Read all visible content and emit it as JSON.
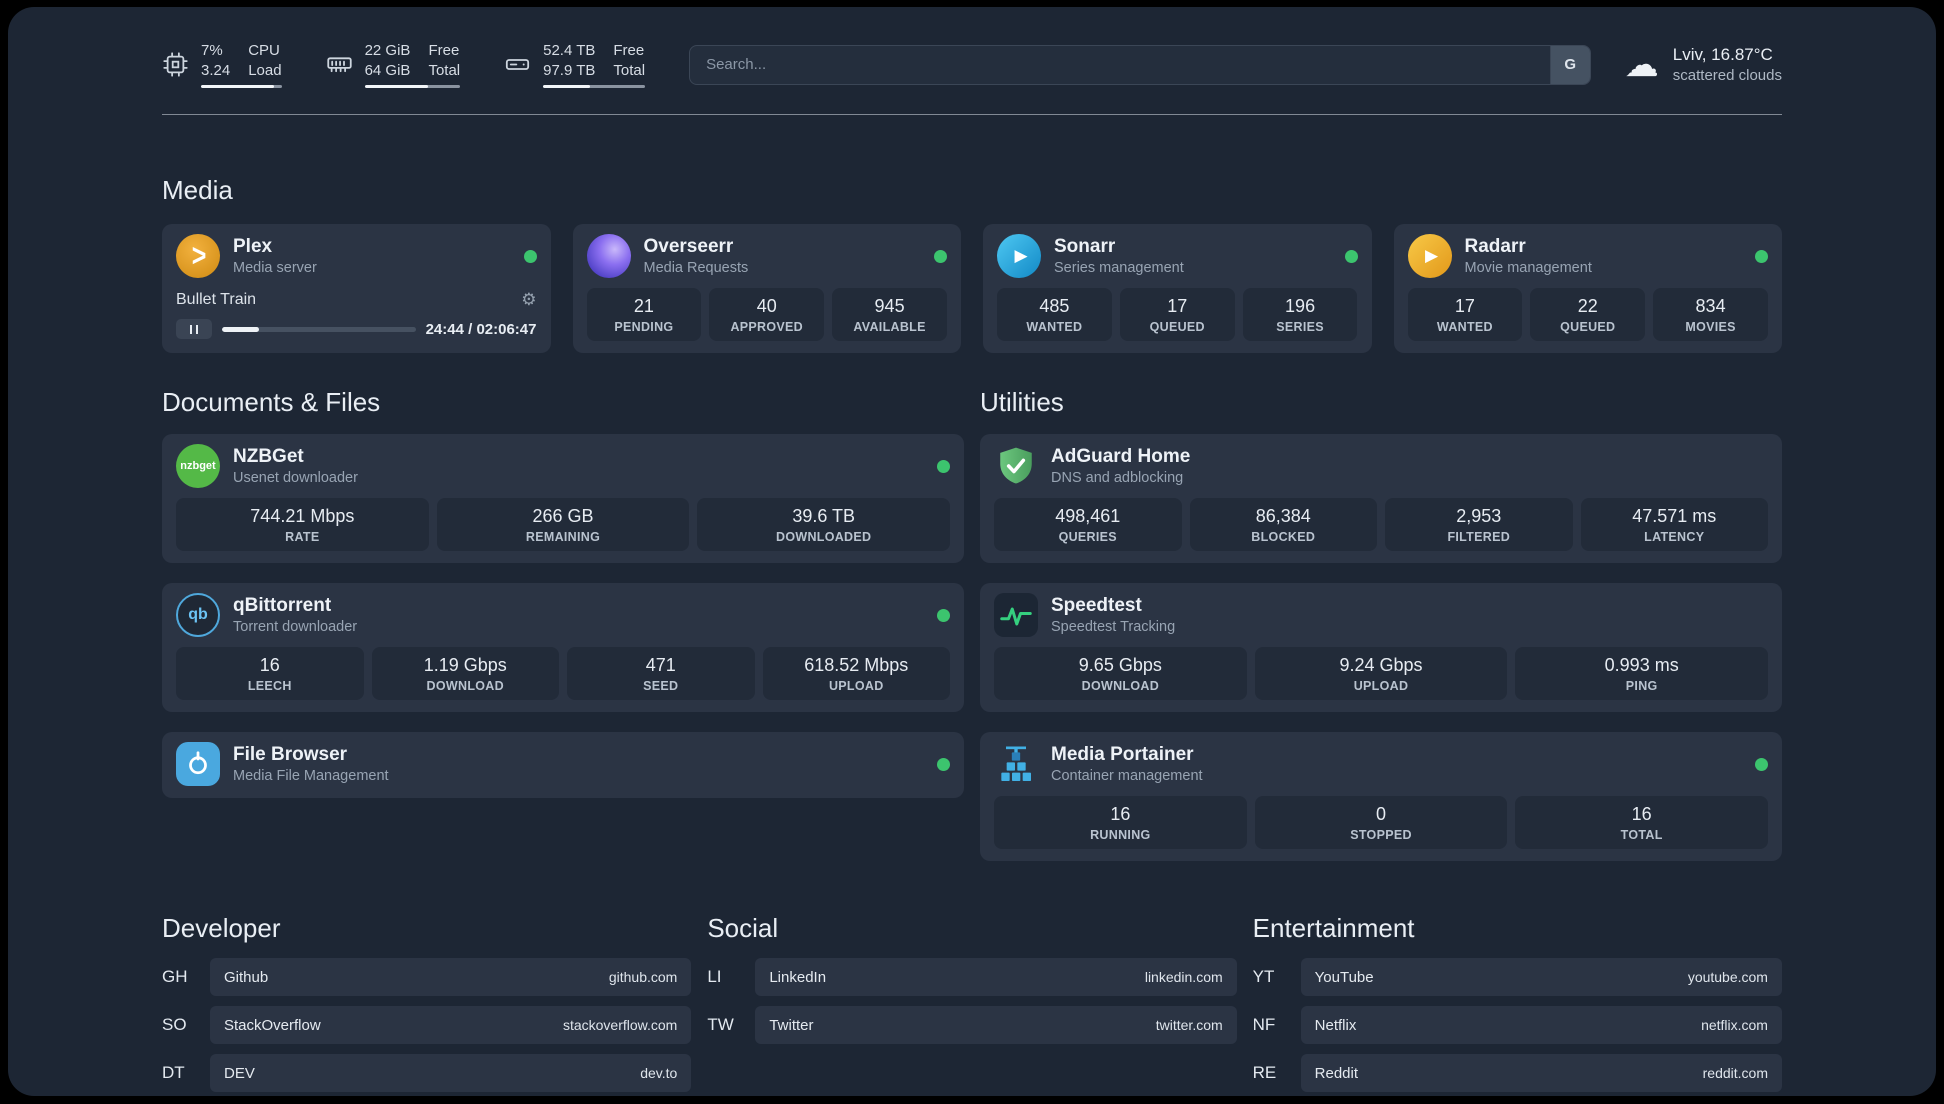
{
  "topbar": {
    "monitors": [
      {
        "icon": "cpu-icon",
        "value_top": "7%",
        "value_bottom": "3.24",
        "label_top": "CPU",
        "label_bottom": "Load",
        "progress_pct": 90
      },
      {
        "icon": "memory-icon",
        "value_top": "22 GiB",
        "value_bottom": "64 GiB",
        "label_top": "Free",
        "label_bottom": "Total",
        "progress_pct": 66
      },
      {
        "icon": "disk-icon",
        "value_top": "52.4 TB",
        "value_bottom": "97.9 TB",
        "label_top": "Free",
        "label_bottom": "Total",
        "progress_pct": 46
      }
    ],
    "search": {
      "placeholder": "Search...",
      "provider_button": "G"
    },
    "weather": {
      "icon": "cloud-icon",
      "location": "Lviv, 16.87°C",
      "condition": "scattered clouds"
    }
  },
  "icon_glyphs": {
    "plex": ">",
    "sonarr": "▶",
    "radarr": "▶",
    "nzbget": "nzbget",
    "qbittorrent": "qb",
    "settings": "⚙",
    "cloud": "☁"
  },
  "sections": {
    "media": {
      "title": "Media",
      "plex": {
        "title": "Plex",
        "subtitle": "Media server",
        "status": "online",
        "player": {
          "track": "Bullet Train",
          "time": "24:44 / 02:06:47",
          "progress_pct": 19
        }
      },
      "overseerr": {
        "title": "Overseerr",
        "subtitle": "Media Requests",
        "status": "online",
        "stats": [
          {
            "value": "21",
            "label": "PENDING"
          },
          {
            "value": "40",
            "label": "APPROVED"
          },
          {
            "value": "945",
            "label": "AVAILABLE"
          }
        ]
      },
      "sonarr": {
        "title": "Sonarr",
        "subtitle": "Series management",
        "status": "online",
        "stats": [
          {
            "value": "485",
            "label": "WANTED"
          },
          {
            "value": "17",
            "label": "QUEUED"
          },
          {
            "value": "196",
            "label": "SERIES"
          }
        ]
      },
      "radarr": {
        "title": "Radarr",
        "subtitle": "Movie management",
        "status": "online",
        "stats": [
          {
            "value": "17",
            "label": "WANTED"
          },
          {
            "value": "22",
            "label": "QUEUED"
          },
          {
            "value": "834",
            "label": "MOVIES"
          }
        ]
      }
    },
    "documents": {
      "title": "Documents & Files",
      "nzbget": {
        "title": "NZBGet",
        "subtitle": "Usenet downloader",
        "status": "online",
        "stats": [
          {
            "value": "744.21 Mbps",
            "label": "RATE"
          },
          {
            "value": "266 GB",
            "label": "REMAINING"
          },
          {
            "value": "39.6 TB",
            "label": "DOWNLOADED"
          }
        ]
      },
      "qbittorrent": {
        "title": "qBittorrent",
        "subtitle": "Torrent downloader",
        "status": "online",
        "stats": [
          {
            "value": "16",
            "label": "LEECH"
          },
          {
            "value": "1.19 Gbps",
            "label": "DOWNLOAD"
          },
          {
            "value": "471",
            "label": "SEED"
          },
          {
            "value": "618.52 Mbps",
            "label": "UPLOAD"
          }
        ]
      },
      "filebrowser": {
        "title": "File Browser",
        "subtitle": "Media File Management",
        "status": "online"
      }
    },
    "utilities": {
      "title": "Utilities",
      "adguard": {
        "title": "AdGuard Home",
        "subtitle": "DNS and adblocking",
        "stats": [
          {
            "value": "498,461",
            "label": "QUERIES"
          },
          {
            "value": "86,384",
            "label": "BLOCKED"
          },
          {
            "value": "2,953",
            "label": "FILTERED"
          },
          {
            "value": "47.571 ms",
            "label": "LATENCY"
          }
        ]
      },
      "speedtest": {
        "title": "Speedtest",
        "subtitle": "Speedtest Tracking",
        "stats": [
          {
            "value": "9.65 Gbps",
            "label": "DOWNLOAD"
          },
          {
            "value": "9.24 Gbps",
            "label": "UPLOAD"
          },
          {
            "value": "0.993 ms",
            "label": "PING"
          }
        ]
      },
      "portainer": {
        "title": "Media Portainer",
        "subtitle": "Container management",
        "status": "online",
        "stats": [
          {
            "value": "16",
            "label": "RUNNING"
          },
          {
            "value": "0",
            "label": "STOPPED"
          },
          {
            "value": "16",
            "label": "TOTAL"
          }
        ]
      }
    }
  },
  "bookmarks": {
    "developer": {
      "title": "Developer",
      "items": [
        {
          "abbr": "GH",
          "name": "Github",
          "domain": "github.com"
        },
        {
          "abbr": "SO",
          "name": "StackOverflow",
          "domain": "stackoverflow.com"
        },
        {
          "abbr": "DT",
          "name": "DEV",
          "domain": "dev.to"
        }
      ]
    },
    "social": {
      "title": "Social",
      "items": [
        {
          "abbr": "LI",
          "name": "LinkedIn",
          "domain": "linkedin.com"
        },
        {
          "abbr": "TW",
          "name": "Twitter",
          "domain": "twitter.com"
        }
      ]
    },
    "entertainment": {
      "title": "Entertainment",
      "items": [
        {
          "abbr": "YT",
          "name": "YouTube",
          "domain": "youtube.com"
        },
        {
          "abbr": "NF",
          "name": "Netflix",
          "domain": "netflix.com"
        },
        {
          "abbr": "RE",
          "name": "Reddit",
          "domain": "reddit.com"
        }
      ]
    }
  },
  "colors": {
    "background": "#1d2634",
    "card": "#2b3444",
    "tile": "#222b39",
    "status_online": "#3cc46e",
    "plex": "#e8a33d",
    "overseerr": "#6d5ce8",
    "sonarr": "#33b2e6",
    "radarr": "#f0b432",
    "nzbget": "#54b947",
    "qbittorrent": "#4fa8dc",
    "filebrowser": "#4aa8df",
    "adguard": "#5fba6e",
    "speedtest": "#2ecc71",
    "portainer": "#41b0e5"
  }
}
